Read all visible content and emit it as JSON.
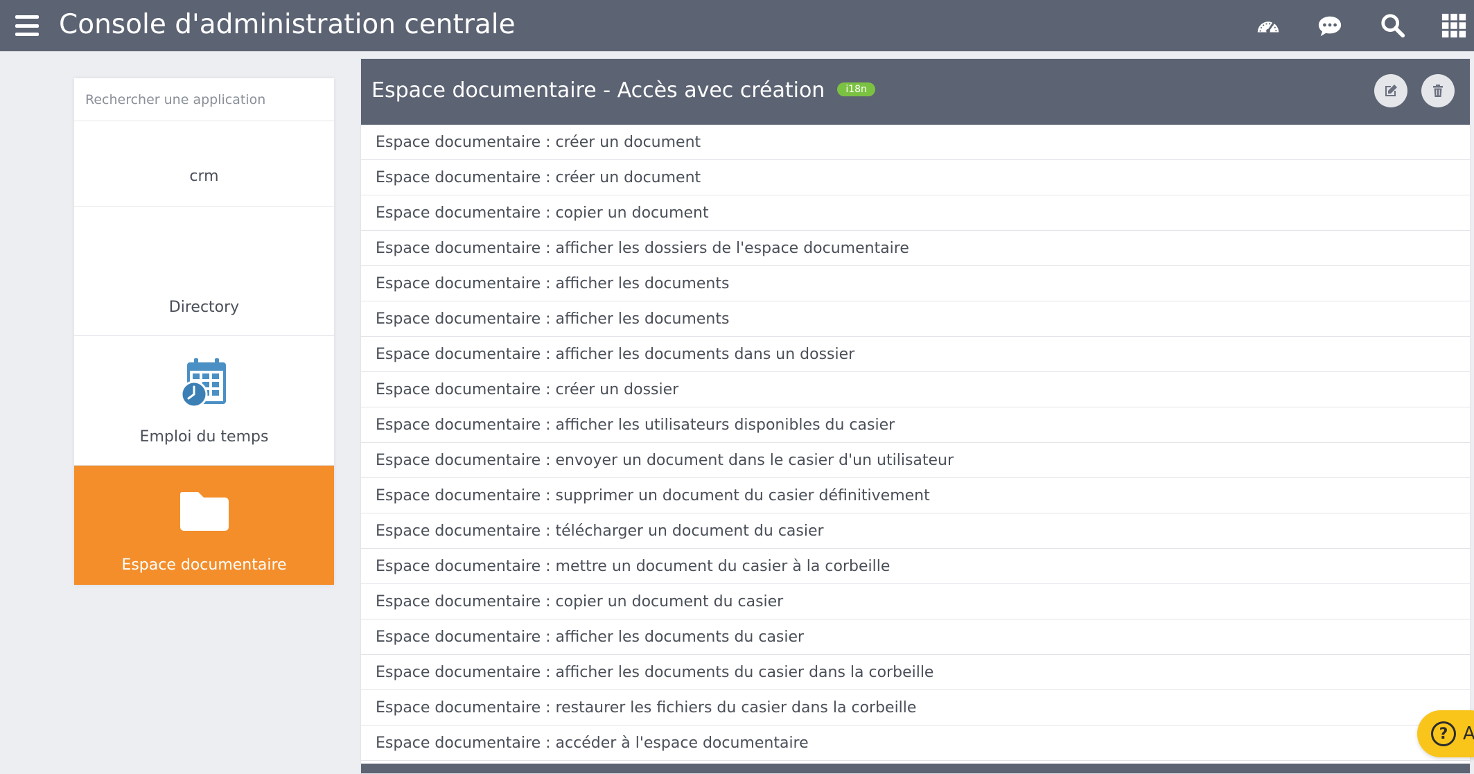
{
  "header": {
    "title": "Console d'administration centrale",
    "icons": [
      "hamburger-menu-icon",
      "speedometer-icon",
      "chat-bubble-icon",
      "search-icon",
      "apps-grid-icon"
    ],
    "background_color": "#5c6373"
  },
  "sidebar": {
    "search_placeholder": "Rechercher une application",
    "items": [
      {
        "label": "crm",
        "icon": ""
      },
      {
        "label": "Directory",
        "icon": ""
      },
      {
        "label": "Emploi du temps",
        "icon": "calendar-clock-icon"
      },
      {
        "label": "Espace documentaire",
        "icon": "folder-icon",
        "active": true
      }
    ],
    "active_color": "#f38e2b"
  },
  "panel": {
    "title": "Espace documentaire - Accès avec création",
    "badge": "i18n",
    "badge_color": "#7cc242",
    "actions": [
      "edit-icon",
      "trash-icon"
    ],
    "rights": [
      "Espace documentaire : créer un document",
      "Espace documentaire : créer un document",
      "Espace documentaire : copier un document",
      "Espace documentaire : afficher les dossiers de l'espace documentaire",
      "Espace documentaire : afficher les documents",
      "Espace documentaire : afficher les documents",
      "Espace documentaire : afficher les documents dans un dossier",
      "Espace documentaire : créer un dossier",
      "Espace documentaire : afficher les utilisateurs disponibles du casier",
      "Espace documentaire : envoyer un document dans le casier d'un utilisateur",
      "Espace documentaire : supprimer un document du casier définitivement",
      "Espace documentaire : télécharger un document du casier",
      "Espace documentaire : mettre un document du casier à la corbeille",
      "Espace documentaire : copier un document du casier",
      "Espace documentaire : afficher les documents du casier",
      "Espace documentaire : afficher les documents du casier dans la corbeille",
      "Espace documentaire : restaurer les fichiers du casier dans la corbeille",
      "Espace documentaire : accéder à l'espace documentaire"
    ]
  },
  "help": {
    "icon": "help-circle-icon",
    "label": "A",
    "color": "#f9c51b"
  }
}
